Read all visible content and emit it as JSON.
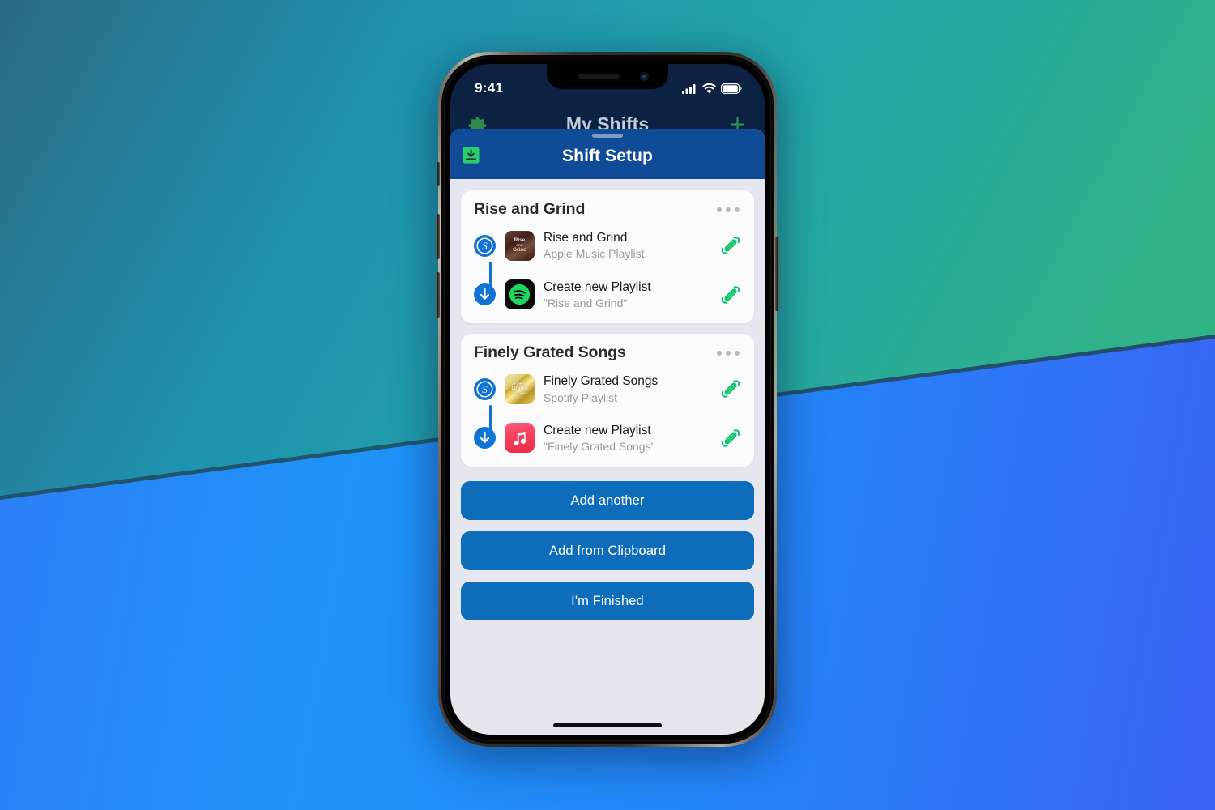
{
  "device": {
    "status_bar": {
      "time": "9:41",
      "cellular_icon": "signal-bars-icon",
      "wifi_icon": "wifi-icon",
      "battery_icon": "battery-icon"
    },
    "home_indicator": "home-indicator"
  },
  "background_screen": {
    "title": "My Shifts",
    "left_icon": "gear-icon",
    "right_icon": "plus-icon",
    "accent": "#2f8f4e"
  },
  "sheet": {
    "title": "Shift Setup",
    "header_bg": "#0f4b96",
    "save_icon": "save-to-inbox-icon",
    "grabber": "drag-grabber"
  },
  "cards": [
    {
      "title": "Rise and Grind",
      "menu_icon": "more-options-icon",
      "rows": [
        {
          "badge": "source-s-icon",
          "artwork": "rise-and-grind-album-art",
          "artwork_lines": [
            "Rise",
            "and",
            "Grind"
          ],
          "title": "Rise and Grind",
          "subtitle": "Apple Music Playlist",
          "edit_icon": "edit-pencil-icon"
        },
        {
          "badge": "destination-arrow-icon",
          "artwork": "spotify-icon",
          "title": "Create new Playlist",
          "subtitle": "\"Rise and Grind\"",
          "edit_icon": "edit-pencil-icon"
        }
      ]
    },
    {
      "title": "Finely Grated Songs",
      "menu_icon": "more-options-icon",
      "rows": [
        {
          "badge": "source-s-icon",
          "artwork": "finely-grated-songs-album-art",
          "artwork_lines": [
            "Finely",
            "Grated",
            "Songs"
          ],
          "title": "Finely Grated Songs",
          "subtitle": "Spotify Playlist",
          "edit_icon": "edit-pencil-icon"
        },
        {
          "badge": "destination-arrow-icon",
          "artwork": "apple-music-icon",
          "title": "Create new Playlist",
          "subtitle": "\"Finely Grated Songs\"",
          "edit_icon": "edit-pencil-icon"
        }
      ]
    }
  ],
  "actions": {
    "add_another": "Add another",
    "add_from_clipboard": "Add from Clipboard",
    "im_finished": "I'm Finished",
    "button_color": "#0d6dbb"
  },
  "colors": {
    "sheet_background": "#e6e6ee",
    "card_background": "#fbfbfd",
    "badge_blue": "#1173d4",
    "edit_green": "#0bc268",
    "wallpaper_teal": "#22a5a8",
    "wallpaper_blue": "#2f7bf6"
  }
}
